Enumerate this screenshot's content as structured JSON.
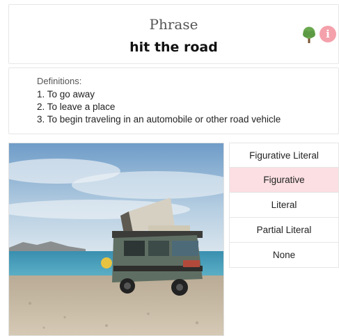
{
  "phrase_card": {
    "type_label": "Phrase",
    "phrase": "hit the road",
    "icons": [
      "tree-icon",
      "info-icon"
    ],
    "info_glyph": "i",
    "colors": {
      "tree": "#6aa84f",
      "info": "#f4a1ab"
    }
  },
  "definitions": {
    "title": "Definitions:",
    "items": [
      "1. To go away",
      "2. To leave a place",
      "3. To begin traveling in an automobile or other road vehicle"
    ]
  },
  "image": {
    "subject": "camper-van-on-beach"
  },
  "options": {
    "items": [
      "Figurative Literal",
      "Figurative",
      "Literal",
      "Partial Literal",
      "None"
    ],
    "selected": "Figurative",
    "selected_color": "#fbdfe2"
  }
}
